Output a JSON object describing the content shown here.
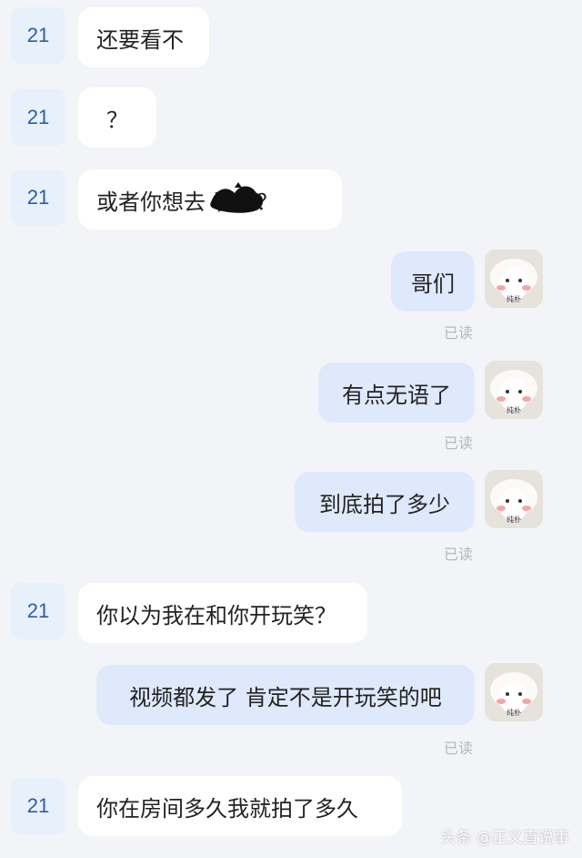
{
  "messages": [
    {
      "sender_label": "21",
      "text": "还要看不"
    },
    {
      "sender_label": "21",
      "text": "？"
    },
    {
      "sender_label": "21",
      "text": "或者你想去  看看？"
    },
    {
      "text": "哥们",
      "status": "已读"
    },
    {
      "text": "有点无语了",
      "status": "已读"
    },
    {
      "text": "到底拍了多少",
      "status": "已读"
    },
    {
      "sender_label": "21",
      "text": "你以为我在和你开玩笑？"
    },
    {
      "text": "视频都发了 肯定不是开玩笑的吧",
      "status": "已读"
    },
    {
      "sender_label": "21",
      "text": "你在房间多久我就拍了多久"
    }
  ],
  "avatar_sticker_text": "纯朴",
  "watermark": "头条 @正义直说事",
  "colors": {
    "background": "#f3f4f8",
    "incoming_bubble": "#ffffff",
    "outgoing_bubble": "#dfe9fc",
    "sender_label": "#2a5ea8",
    "read_status": "#b5b8bf"
  }
}
